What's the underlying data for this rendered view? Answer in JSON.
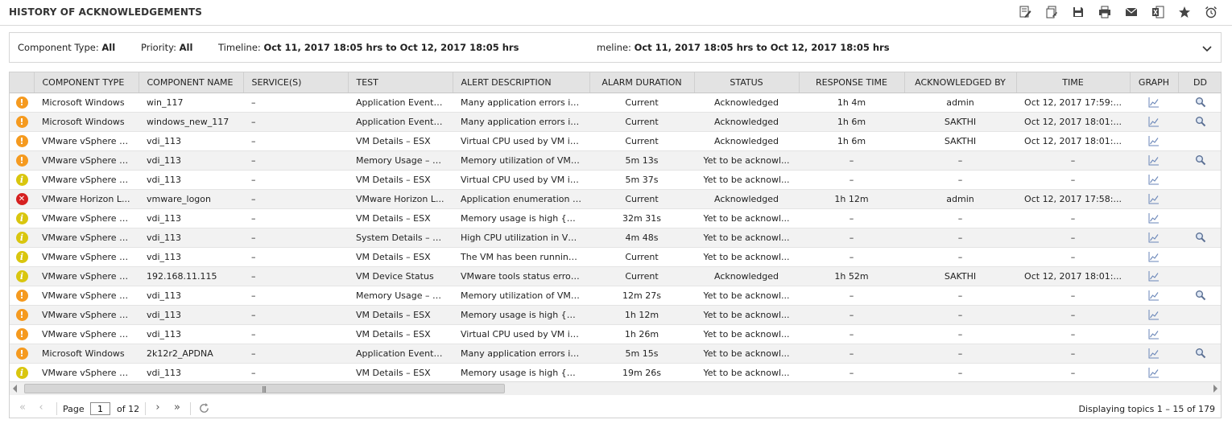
{
  "header": {
    "title": "HISTORY OF ACKNOWLEDGEMENTS",
    "toolbar": [
      {
        "name": "edit-report-icon"
      },
      {
        "name": "copy-report-icon"
      },
      {
        "name": "save-icon"
      },
      {
        "name": "print-icon"
      },
      {
        "name": "email-icon"
      },
      {
        "name": "excel-export-icon"
      },
      {
        "name": "favorite-star-icon"
      },
      {
        "name": "alarm-clock-icon"
      }
    ]
  },
  "filters": {
    "component_type_label": "Component Type:",
    "component_type_value": "All",
    "priority_label": "Priority:",
    "priority_value": "All",
    "timeline_label": "Timeline:",
    "timeline_value": "Oct 11, 2017 18:05 hrs to Oct 12, 2017 18:05 hrs",
    "timeline_dup_label": "meline:",
    "timeline_dup_value": "Oct 11, 2017 18:05 hrs to Oct 12, 2017 18:05 hrs"
  },
  "table": {
    "columns": [
      "",
      "COMPONENT TYPE",
      "COMPONENT NAME",
      "SERVICE(S)",
      "TEST",
      "ALERT DESCRIPTION",
      "ALARM DURATION",
      "STATUS",
      "RESPONSE TIME",
      "ACKNOWLEDGED BY",
      "TIME",
      "GRAPH",
      "DD"
    ],
    "severity_colors": {
      "major": "#f59a1f",
      "minor": "#d9c60e",
      "critical": "#d62020"
    },
    "rows": [
      {
        "severity": "major",
        "severity_glyph": "!",
        "type": "Microsoft Windows",
        "name": "win_117",
        "services": "–",
        "test": "Application Event ...",
        "desc": "Many application errors in t...",
        "duration": "Current",
        "status": "Acknowledged",
        "response": "1h 4m",
        "ack_by": "admin",
        "time": "Oct 12, 2017 17:59:...",
        "dd": true
      },
      {
        "severity": "major",
        "severity_glyph": "!",
        "type": "Microsoft Windows",
        "name": "windows_new_117",
        "services": "–",
        "test": "Application Event ...",
        "desc": "Many application errors in t...",
        "duration": "Current",
        "status": "Acknowledged",
        "response": "1h 6m",
        "ack_by": "SAKTHI",
        "time": "Oct 12, 2017 18:01:...",
        "dd": true
      },
      {
        "severity": "major",
        "severity_glyph": "!",
        "type": "VMware vSphere VDI",
        "name": "vdi_113",
        "services": "–",
        "test": "VM Details – ESX",
        "desc": "Virtual CPU used by VM is h...",
        "duration": "Current",
        "status": "Acknowledged",
        "response": "1h 6m",
        "ack_by": "SAKTHI",
        "time": "Oct 12, 2017 18:01:...",
        "dd": false
      },
      {
        "severity": "major",
        "severity_glyph": "!",
        "type": "VMware vSphere VDI",
        "name": "vdi_113",
        "services": "–",
        "test": "Memory Usage – VM",
        "desc": "Memory utilization of VM is...",
        "duration": "5m 13s",
        "status": "Yet to be acknowl...",
        "response": "–",
        "ack_by": "–",
        "time": "–",
        "dd": true
      },
      {
        "severity": "minor",
        "severity_glyph": "i",
        "type": "VMware vSphere VDI",
        "name": "vdi_113",
        "services": "–",
        "test": "VM Details – ESX",
        "desc": "Virtual CPU used by VM is h...",
        "duration": "5m 37s",
        "status": "Yet to be acknowl...",
        "response": "–",
        "ack_by": "–",
        "time": "–",
        "dd": false
      },
      {
        "severity": "critical",
        "severity_glyph": "✕",
        "type": "VMware Horizon L...",
        "name": "vmware_logon",
        "services": "–",
        "test": "VMware Horizon L...",
        "desc": "Application enumeration fai...",
        "duration": "Current",
        "status": "Acknowledged",
        "response": "1h 12m",
        "ack_by": "admin",
        "time": "Oct 12, 2017 17:58:...",
        "dd": false
      },
      {
        "severity": "minor",
        "severity_glyph": "i",
        "type": "VMware vSphere VDI",
        "name": "vdi_113",
        "services": "–",
        "test": "VM Details – ESX",
        "desc": "Memory usage is high {WIN...",
        "duration": "32m 31s",
        "status": "Yet to be acknowl...",
        "response": "–",
        "ack_by": "–",
        "time": "–",
        "dd": false
      },
      {
        "severity": "minor",
        "severity_glyph": "i",
        "type": "VMware vSphere VDI",
        "name": "vdi_113",
        "services": "–",
        "test": "System Details – VM",
        "desc": "High CPU utilization in VM {...",
        "duration": "4m 48s",
        "status": "Yet to be acknowl...",
        "response": "–",
        "ack_by": "–",
        "time": "–",
        "dd": true
      },
      {
        "severity": "minor",
        "severity_glyph": "i",
        "type": "VMware vSphere VDI",
        "name": "vdi_113",
        "services": "–",
        "test": "VM Details – ESX",
        "desc": "The VM has been running f...",
        "duration": "Current",
        "status": "Yet to be acknowl...",
        "response": "–",
        "ack_by": "–",
        "time": "–",
        "dd": false
      },
      {
        "severity": "minor",
        "severity_glyph": "i",
        "type": "VMware vSphere VDI",
        "name": "192.168.11.115",
        "services": "–",
        "test": "VM Device Status",
        "desc": "VMware tools status error {...",
        "duration": "Current",
        "status": "Acknowledged",
        "response": "1h 52m",
        "ack_by": "SAKTHI",
        "time": "Oct 12, 2017 18:01:...",
        "dd": false
      },
      {
        "severity": "major",
        "severity_glyph": "!",
        "type": "VMware vSphere VDI",
        "name": "vdi_113",
        "services": "–",
        "test": "Memory Usage – VM",
        "desc": "Memory utilization of VM is...",
        "duration": "12m 27s",
        "status": "Yet to be acknowl...",
        "response": "–",
        "ack_by": "–",
        "time": "–",
        "dd": true
      },
      {
        "severity": "major",
        "severity_glyph": "!",
        "type": "VMware vSphere VDI",
        "name": "vdi_113",
        "services": "–",
        "test": "VM Details – ESX",
        "desc": "Memory usage is high {WIN...",
        "duration": "1h 12m",
        "status": "Yet to be acknowl...",
        "response": "–",
        "ack_by": "–",
        "time": "–",
        "dd": false
      },
      {
        "severity": "major",
        "severity_glyph": "!",
        "type": "VMware vSphere VDI",
        "name": "vdi_113",
        "services": "–",
        "test": "VM Details – ESX",
        "desc": "Virtual CPU used by VM is h...",
        "duration": "1h 26m",
        "status": "Yet to be acknowl...",
        "response": "–",
        "ack_by": "–",
        "time": "–",
        "dd": false
      },
      {
        "severity": "major",
        "severity_glyph": "!",
        "type": "Microsoft Windows",
        "name": "2k12r2_APDNA",
        "services": "–",
        "test": "Application Event ...",
        "desc": "Many application errors in t...",
        "duration": "5m 15s",
        "status": "Yet to be acknowl...",
        "response": "–",
        "ack_by": "–",
        "time": "–",
        "dd": true
      },
      {
        "severity": "minor",
        "severity_glyph": "i",
        "type": "VMware vSphere VDI",
        "name": "vdi_113",
        "services": "–",
        "test": "VM Details – ESX",
        "desc": "Memory usage is high {WIN...",
        "duration": "19m 26s",
        "status": "Yet to be acknowl...",
        "response": "–",
        "ack_by": "–",
        "time": "–",
        "dd": false
      }
    ]
  },
  "scrollbar": {
    "grip": "|||"
  },
  "pager": {
    "page_label": "Page",
    "page_value": "1",
    "of_label": "of 12",
    "status": "Displaying topics 1 – 15 of 179"
  }
}
